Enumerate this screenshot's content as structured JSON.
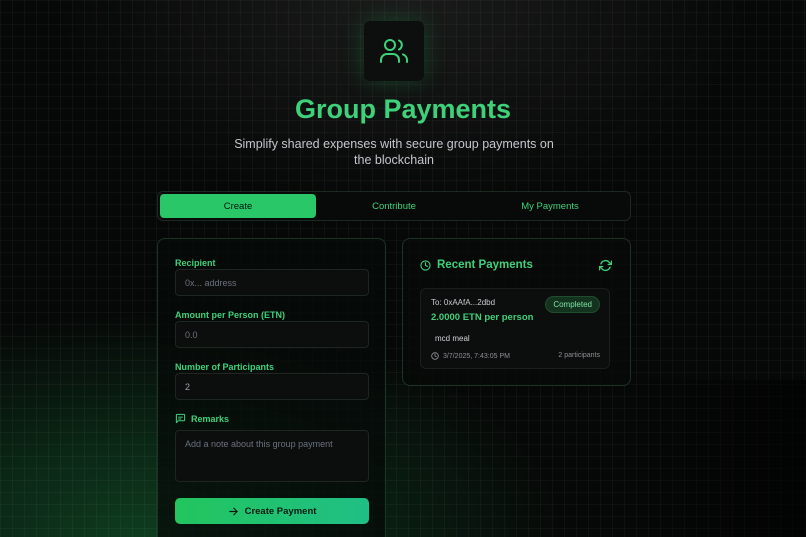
{
  "header": {
    "logo_icon": "users-icon",
    "title": "Group Payments",
    "subtitle": "Simplify shared expenses with secure group payments on the blockchain"
  },
  "tabs": [
    {
      "label": "Create",
      "active": true
    },
    {
      "label": "Contribute",
      "active": false
    },
    {
      "label": "My Payments",
      "active": false
    }
  ],
  "form": {
    "recipient_label": "Recipient",
    "recipient_placeholder": "0x... address",
    "amount_label": "Amount per Person (ETN)",
    "amount_placeholder": "0.0",
    "participants_label": "Number of Participants",
    "participants_value": "2",
    "remarks_label": "Remarks",
    "remarks_placeholder": "Add a note about this group payment",
    "submit_label": "Create Payment"
  },
  "recent": {
    "title": "Recent Payments",
    "items": [
      {
        "to": "To: 0xAAfA...2dbd",
        "amount": "2.0000 ETN per person",
        "status": "Completed",
        "note": "mcd meal",
        "date": "3/7/2025, 7:43:05 PM",
        "participants": "2 participants"
      }
    ]
  },
  "colors": {
    "accent": "#3fd17a",
    "button": "#22c55e",
    "background": "#060807"
  }
}
